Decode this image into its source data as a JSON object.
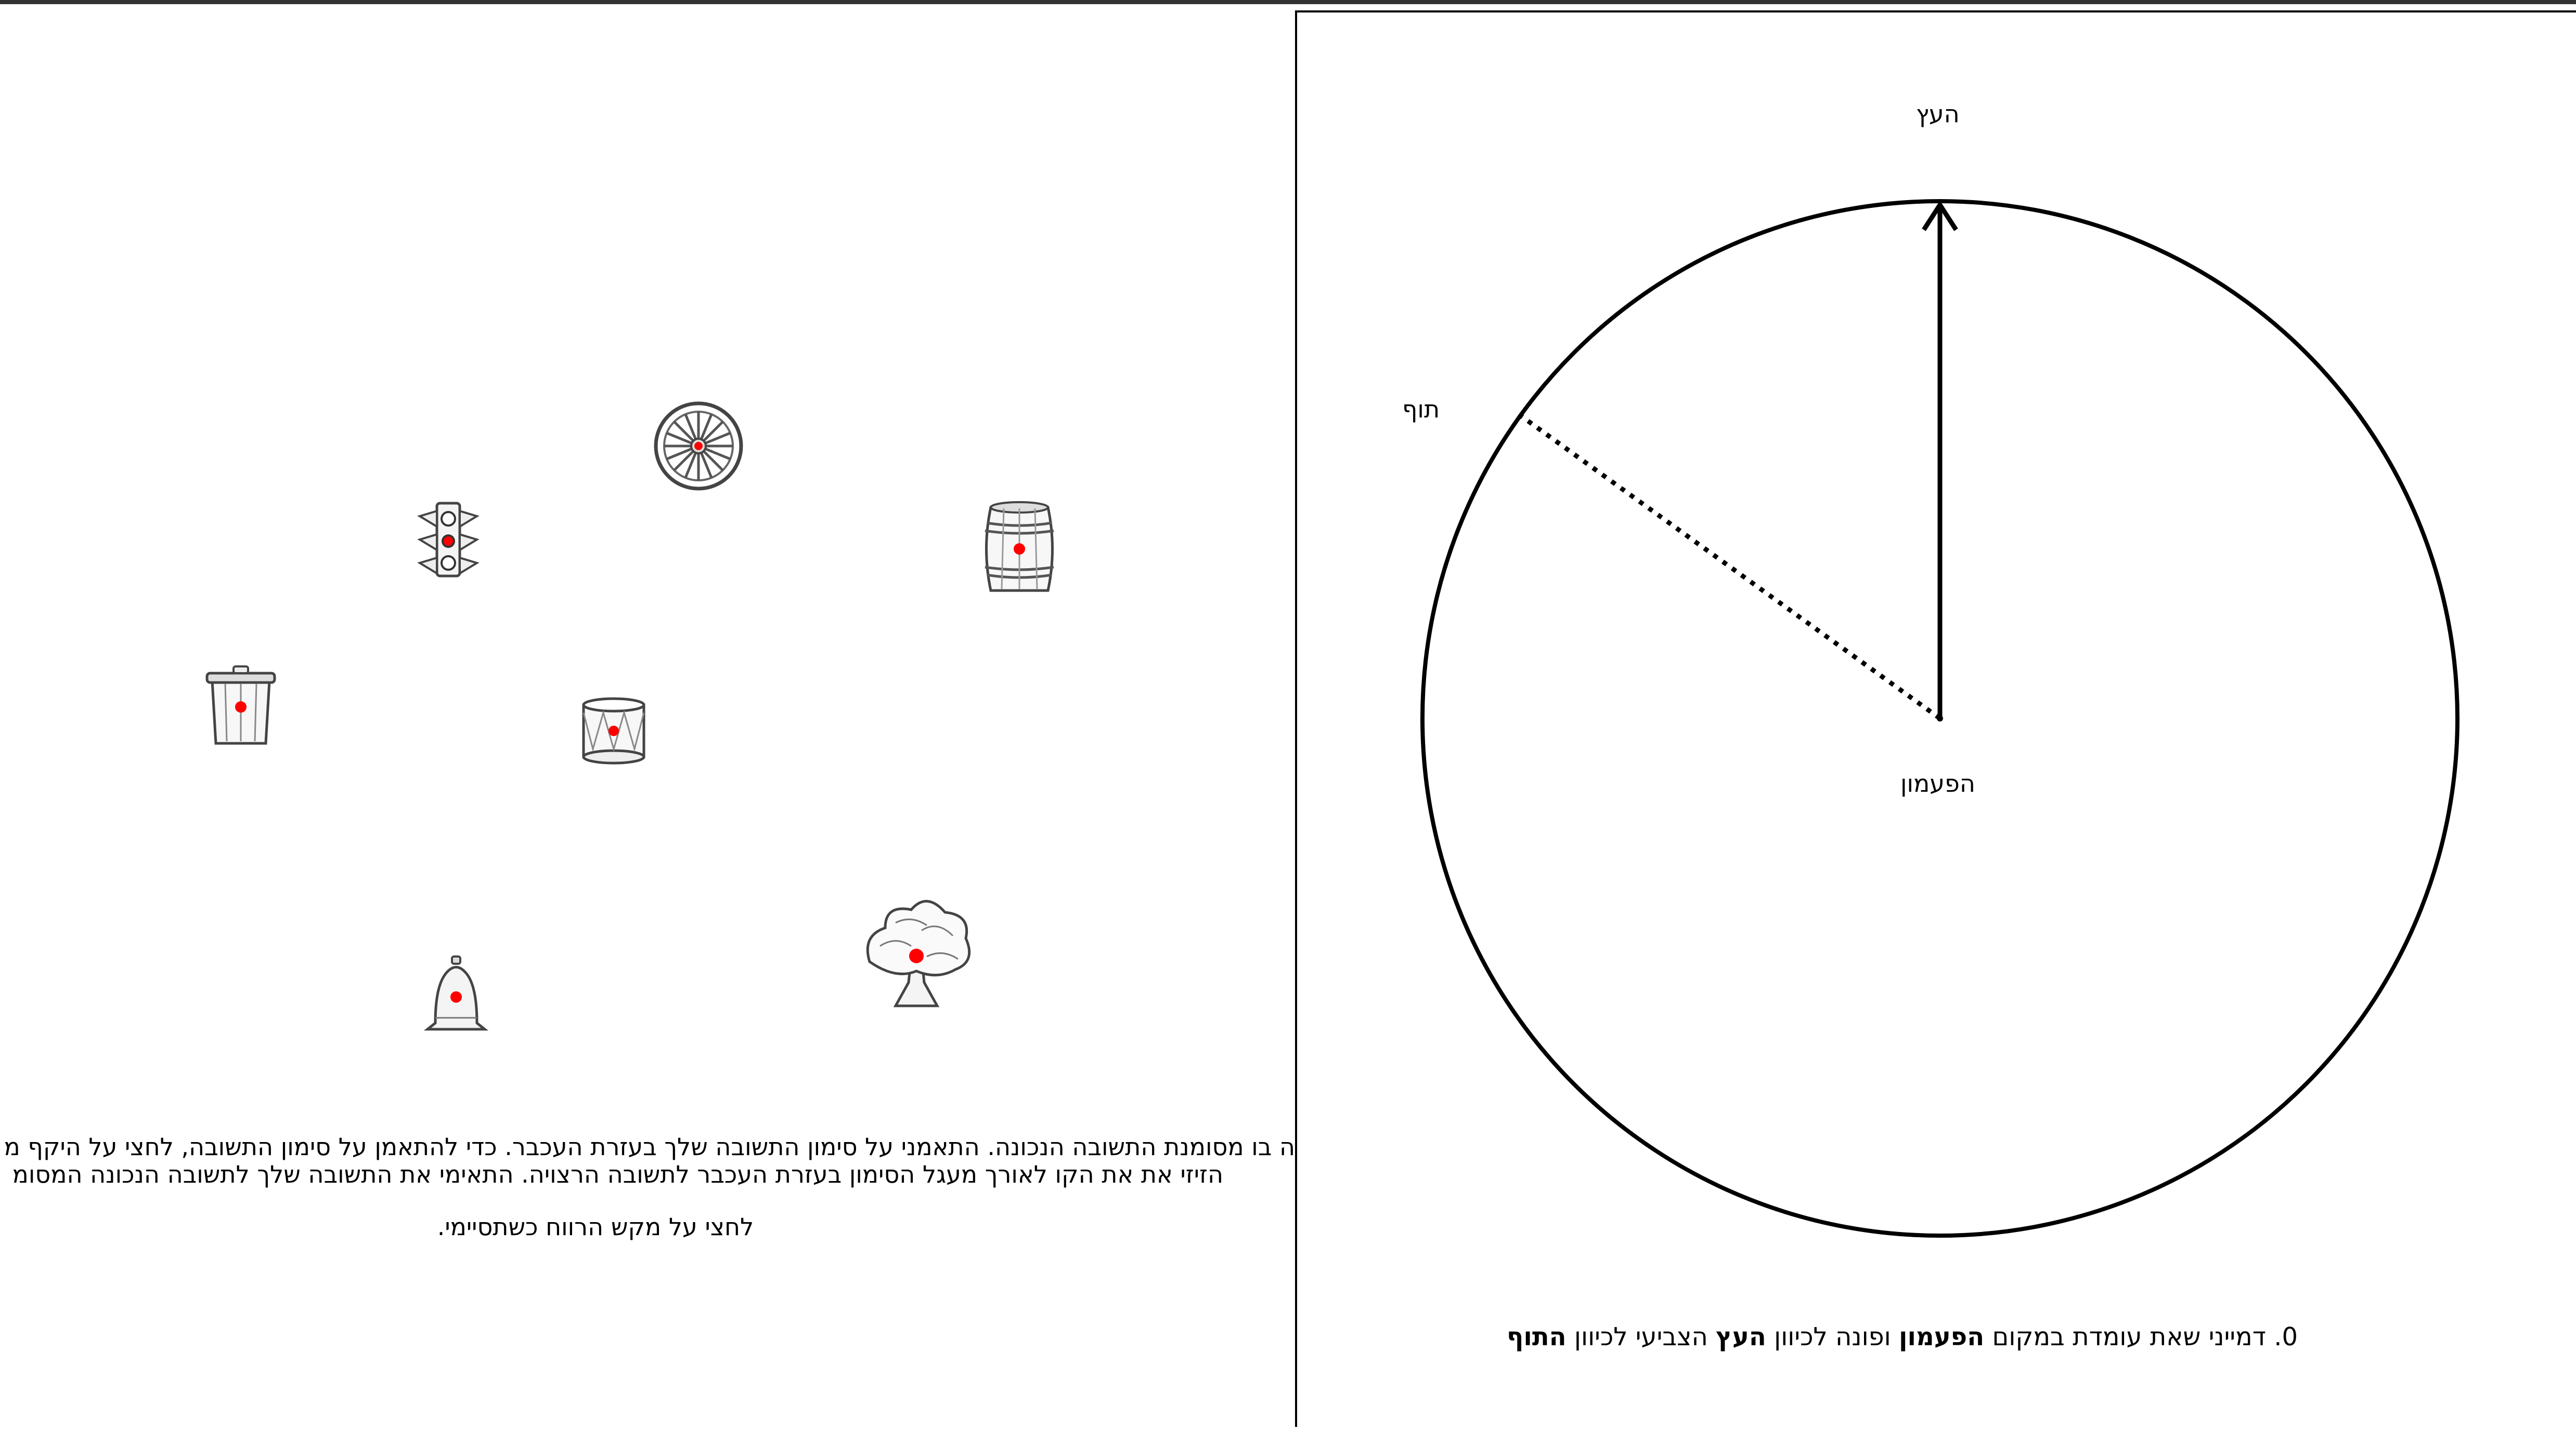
{
  "instructions": {
    "line1": "ה בו מסומנת התשובה הנכונה. התאמני על סימון התשובה שלך בעזרת העכבר. כדי להתאמן על סימון התשובה, לחצי על היקף מ",
    "line2": "הזיזי את את הקו לאורך מעגל הסימון בעזרת העכבר לתשובה הרצויה. התאימי את התשובה שלך לתשובה הנכונה המסומ",
    "line3": "לחצי על מקש הרווח כשתסיימי."
  },
  "scene_objects": [
    {
      "name": "wheel",
      "icon": "wagon-wheel-icon"
    },
    {
      "name": "traffic-light",
      "icon": "traffic-light-icon"
    },
    {
      "name": "barrel",
      "icon": "barrel-icon"
    },
    {
      "name": "trash-can",
      "icon": "trash-can-icon"
    },
    {
      "name": "drum",
      "icon": "drum-icon"
    },
    {
      "name": "bell",
      "icon": "bell-icon"
    },
    {
      "name": "tree",
      "icon": "tree-icon"
    }
  ],
  "task": {
    "label_top": "העץ",
    "label_target": "תוף",
    "label_center": "הפעמון",
    "question_number": "0.",
    "question_part1": "דמייני שאת עומדת במקום",
    "question_standing": "הפעמון",
    "question_part2": "ופונה לכיוון",
    "question_facing": "העץ",
    "question_part3": "הצביעי לכיוון",
    "question_target": "התוף"
  },
  "colors": {
    "marker": "#ff0000",
    "line": "#000000",
    "background": "#ffffff"
  }
}
